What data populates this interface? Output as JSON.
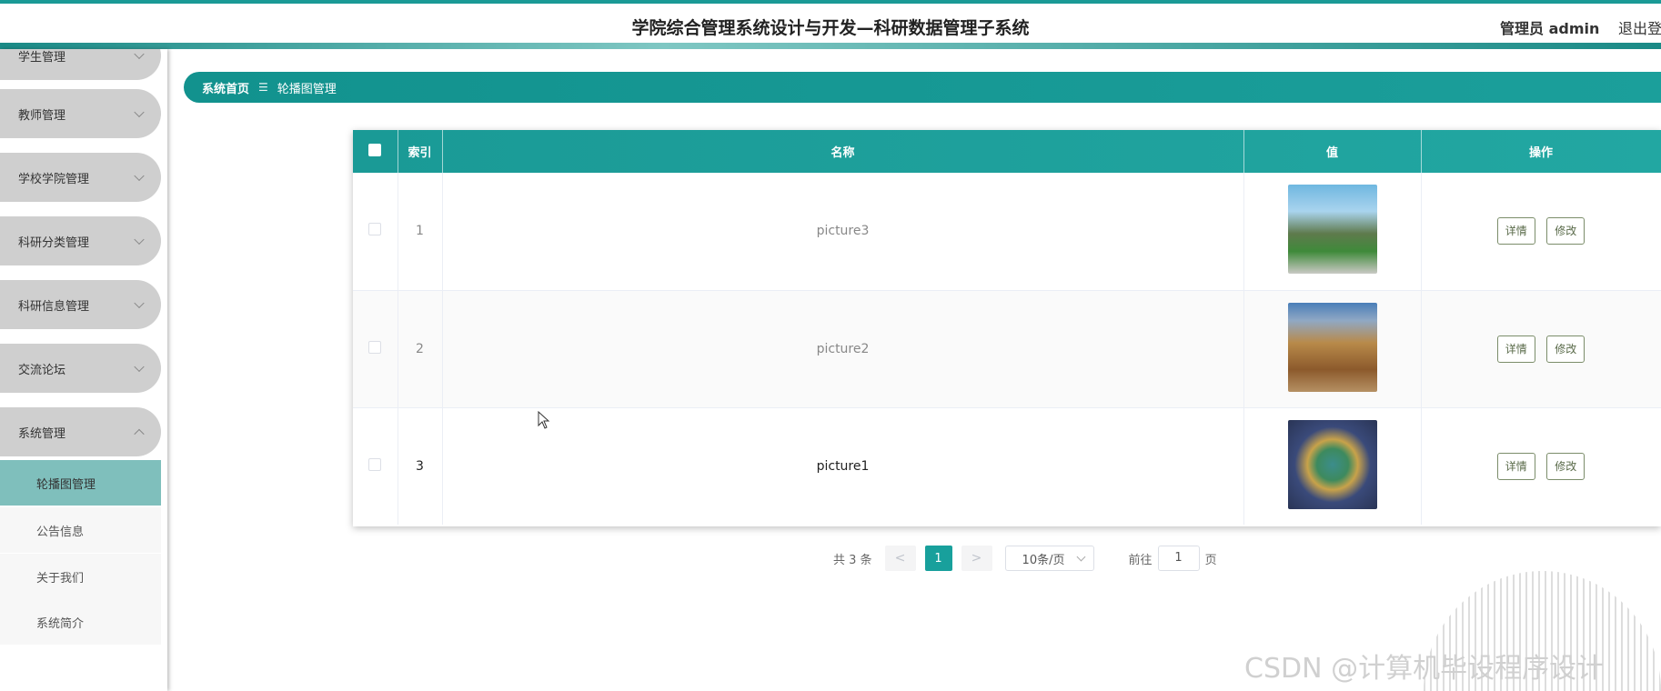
{
  "header": {
    "title": "学院综合管理系统设计与开发—科研数据管理子系统",
    "user": "管理员 admin",
    "logout": "退出登"
  },
  "sidebar": {
    "items": [
      {
        "label": "学生管理"
      },
      {
        "label": "教师管理"
      },
      {
        "label": "学校学院管理"
      },
      {
        "label": "科研分类管理"
      },
      {
        "label": "科研信息管理"
      },
      {
        "label": "交流论坛"
      },
      {
        "label": "系统管理"
      }
    ],
    "sub_items": [
      {
        "label": "轮播图管理"
      },
      {
        "label": "公告信息"
      },
      {
        "label": "关于我们"
      },
      {
        "label": "系统简介"
      }
    ]
  },
  "breadcrumb": {
    "home": "系统首页",
    "separator": "☰",
    "current": "轮播图管理"
  },
  "table": {
    "columns": [
      "索引",
      "名称",
      "值",
      "操作"
    ],
    "rows": [
      {
        "index": "1",
        "name": "picture3",
        "image": "campus-garden-photo"
      },
      {
        "index": "2",
        "name": "picture2",
        "image": "campus-building-photo"
      },
      {
        "index": "3",
        "name": "picture1",
        "image": "campus-aerial-photo"
      }
    ],
    "actions": {
      "detail": "详情",
      "edit": "修改"
    }
  },
  "pager": {
    "total": "共 3 条",
    "prev": "<",
    "current": "1",
    "next": ">",
    "page_size": "10条/页",
    "goto_label": "前往",
    "goto_value": "1",
    "page_unit": "页"
  },
  "watermark": "CSDN @计算机毕设程序设计",
  "colors": {
    "primary": "#1a9a96",
    "active_submenu": "#7fbfbc",
    "menu_bg": "#cfcfcf"
  }
}
